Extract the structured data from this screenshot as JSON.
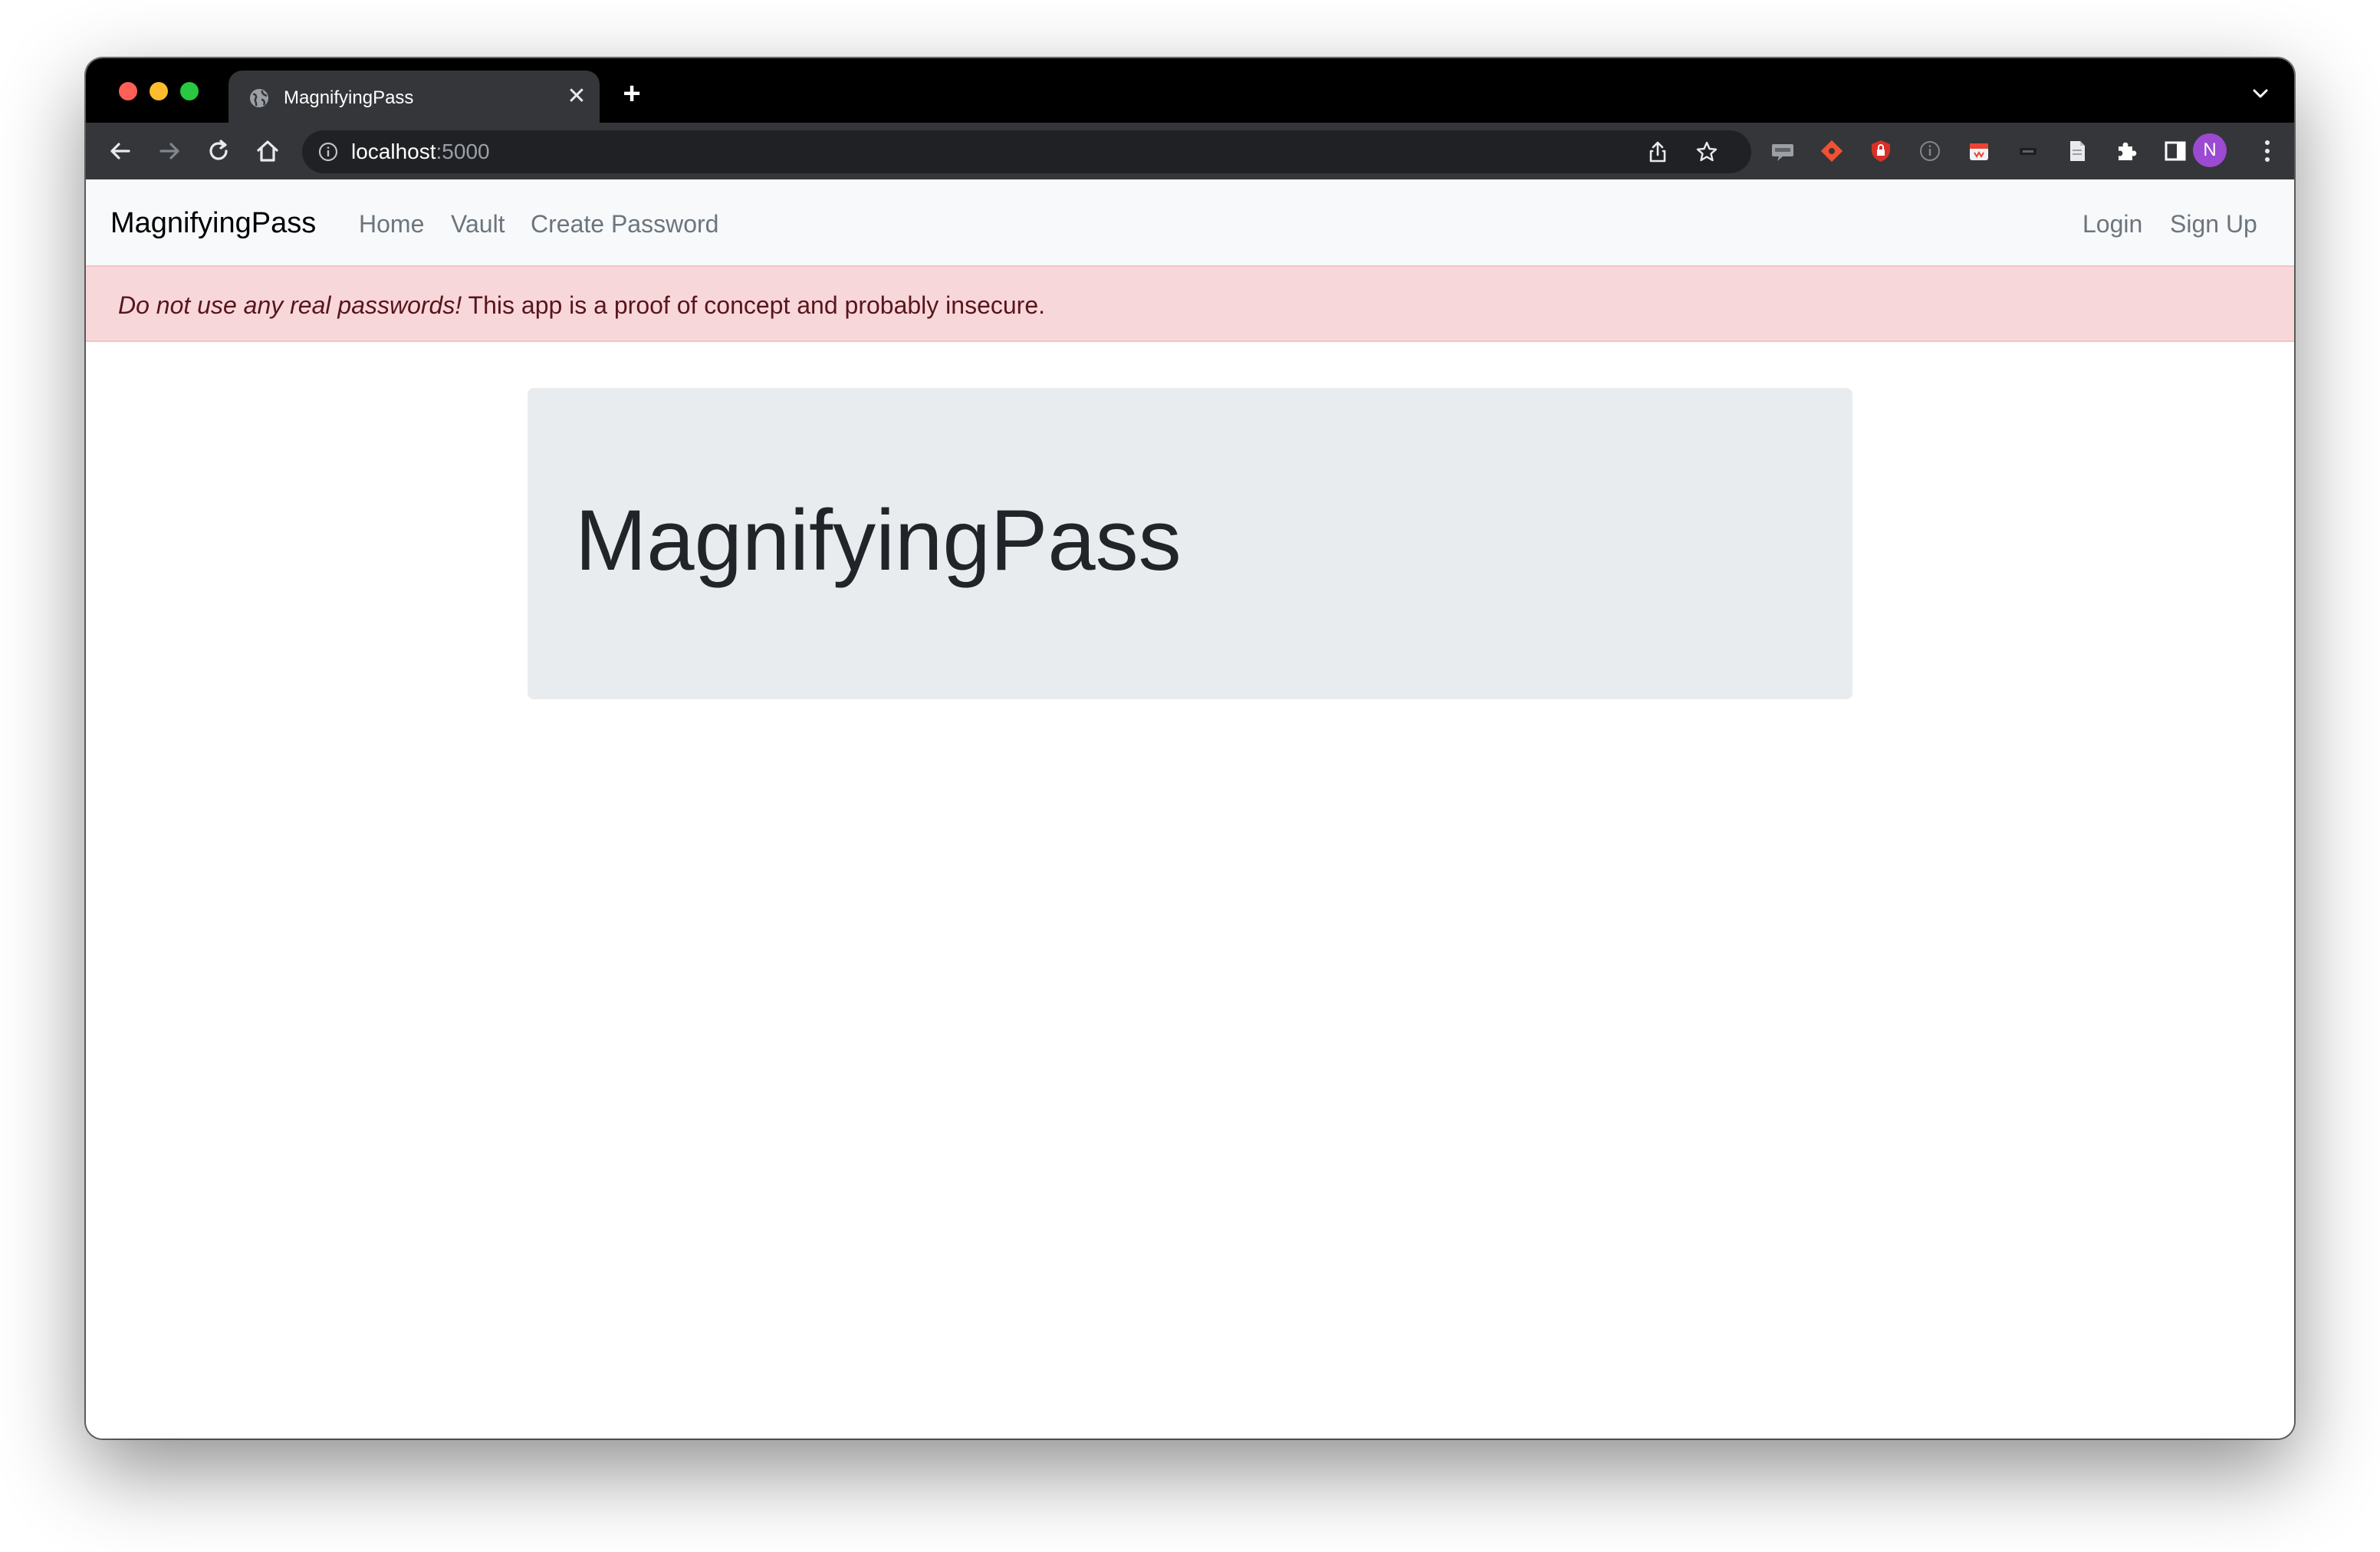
{
  "browser": {
    "tab_title": "MagnifyingPass",
    "url_host": "localhost",
    "url_port": ":5000",
    "profile_initial": "N",
    "new_tab_label": "+",
    "close_tab_label": "✕"
  },
  "navbar": {
    "brand": "MagnifyingPass",
    "links": [
      {
        "label": "Home"
      },
      {
        "label": "Vault"
      },
      {
        "label": "Create Password"
      }
    ],
    "right_links": [
      {
        "label": "Login"
      },
      {
        "label": "Sign Up"
      }
    ]
  },
  "alert": {
    "emphasis": "Do not use any real passwords!",
    "message": " This app is a proof of concept and probably insecure."
  },
  "hero": {
    "title": "MagnifyingPass"
  },
  "colors": {
    "navbar_bg": "#f8f9fa",
    "alert_bg": "#f8d7da",
    "alert_text": "#58151c",
    "hero_bg": "#e9ecef",
    "avatar_bg": "#9c4ad1"
  }
}
